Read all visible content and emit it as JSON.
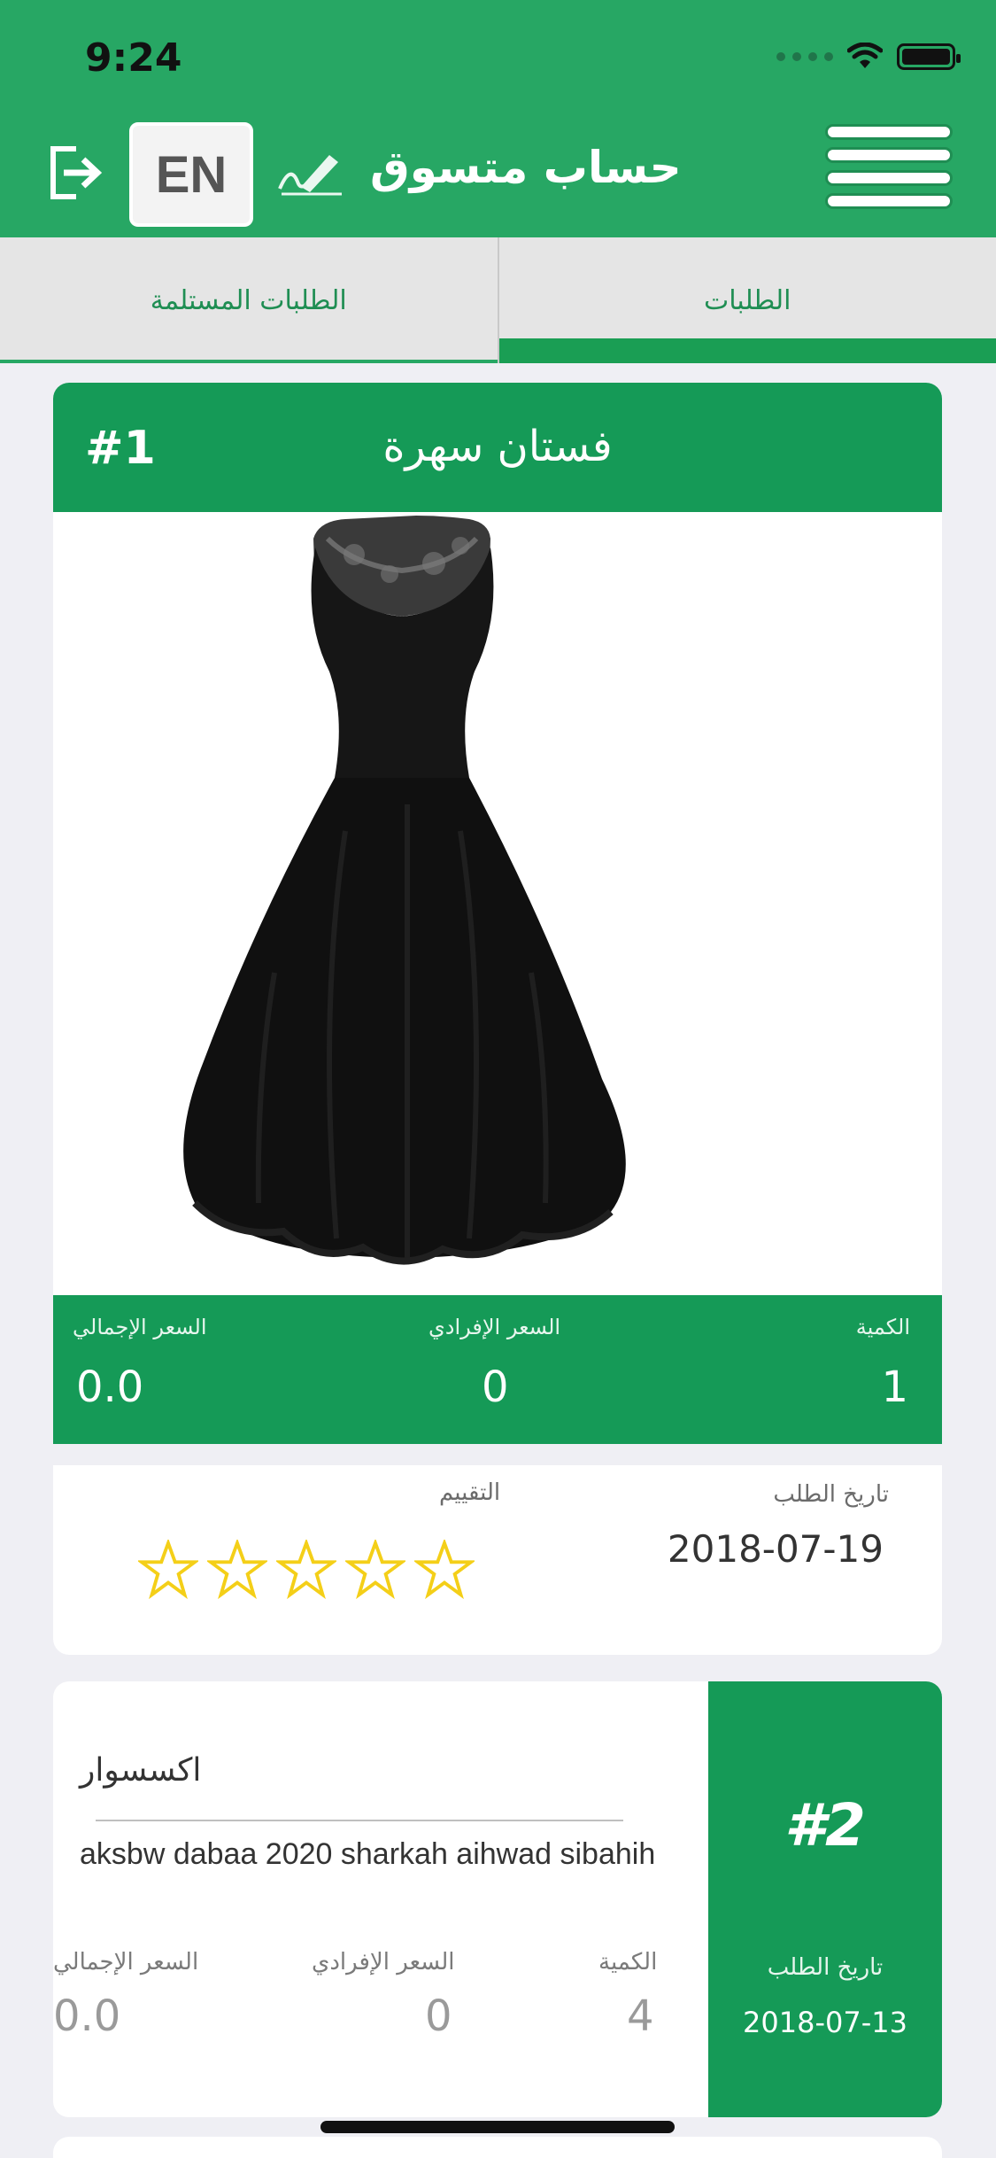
{
  "status_bar": {
    "time": "9:24"
  },
  "header": {
    "title": "حساب متسوق",
    "lang_label": "EN",
    "icons": [
      "logout-icon",
      "sign-icon",
      "menu-icon"
    ]
  },
  "tabs": [
    {
      "label": "الطلبات",
      "active": true
    },
    {
      "label": "الطلبات المستلمة",
      "active": false
    }
  ],
  "orders": [
    {
      "number": "#1",
      "title": "فستان سهرة",
      "image": "black-dress-image",
      "quantity_label": "الكمية",
      "quantity": "1",
      "unit_price_label": "السعر الإفرادي",
      "unit_price": "0",
      "total_label": "السعر الإجمالي",
      "total": "0.0",
      "date_label": "تاريخ الطلب",
      "date": "2018-07-19",
      "rating_label": "التقييم",
      "rating": 0,
      "rating_max": 5
    },
    {
      "number": "#2",
      "title": "اكسسوار",
      "description": "aksbw dabaa 2020 sharkah aihwad sibahih",
      "quantity_label": "الكمية",
      "quantity": "4",
      "unit_price_label": "السعر الإفرادي",
      "unit_price": "0",
      "total_label": "السعر الإجمالي",
      "total": "0.0",
      "date_label": "تاريخ الطلب",
      "date": "2018-07-13"
    }
  ],
  "colors": {
    "primary": "#27a764",
    "primary_dark": "#159a57",
    "star": "#f4cf18",
    "background": "#efeff4"
  }
}
